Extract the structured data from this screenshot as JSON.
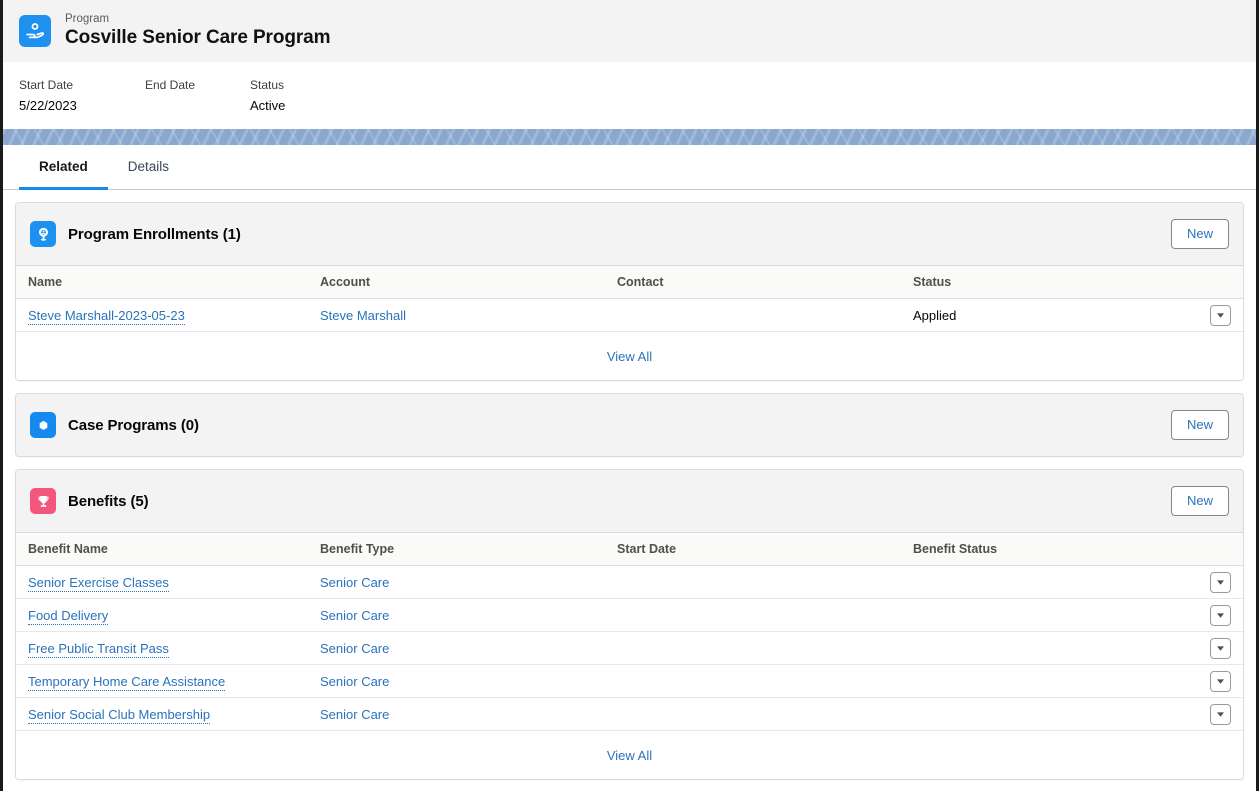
{
  "record": {
    "object_label": "Program",
    "title": "Cosville Senior Care Program",
    "icon": "program-icon",
    "icon_color": "#1e90ef"
  },
  "highlights": [
    {
      "label": "Start Date",
      "value": "5/22/2023"
    },
    {
      "label": "End Date",
      "value": ""
    },
    {
      "label": "Status",
      "value": "Active"
    }
  ],
  "tabs": [
    {
      "label": "Related",
      "active": true
    },
    {
      "label": "Details",
      "active": false
    }
  ],
  "cards": [
    {
      "title": "Program Enrollments (1)",
      "icon": "program-enrollment-icon",
      "icon_color": "#1e90ef",
      "new_label": "New",
      "columns": [
        "Name",
        "Account",
        "Contact",
        "Status"
      ],
      "rows": [
        {
          "name": "Steve Marshall-2023-05-23",
          "account": "Steve Marshall",
          "contact": "",
          "status": "Applied"
        }
      ],
      "view_all_label": "View All"
    },
    {
      "title": "Case Programs (0)",
      "icon": "case-program-icon",
      "icon_color": "#1589ee",
      "new_label": "New",
      "columns": [],
      "rows": [],
      "view_all_label": ""
    },
    {
      "title": "Benefits (5)",
      "icon": "benefit-trophy-icon",
      "icon_color": "#f2567c",
      "new_label": "New",
      "columns": [
        "Benefit Name",
        "Benefit Type",
        "Start Date",
        "Benefit Status"
      ],
      "rows": [
        {
          "name": "Senior Exercise Classes",
          "type": "Senior Care",
          "start_date": "",
          "status": ""
        },
        {
          "name": "Food Delivery",
          "type": "Senior Care",
          "start_date": "",
          "status": ""
        },
        {
          "name": "Free Public Transit Pass",
          "type": "Senior Care",
          "start_date": "",
          "status": ""
        },
        {
          "name": "Temporary Home Care Assistance",
          "type": "Senior Care",
          "start_date": "",
          "status": ""
        },
        {
          "name": "Senior Social Club Membership",
          "type": "Senior Care",
          "start_date": "",
          "status": ""
        }
      ],
      "view_all_label": "View All"
    }
  ],
  "colors": {
    "link": "#2a73bb",
    "tab_active_underline": "#1589ee",
    "banner": "#8aa8cd",
    "header_bg": "#f3f3f3"
  }
}
